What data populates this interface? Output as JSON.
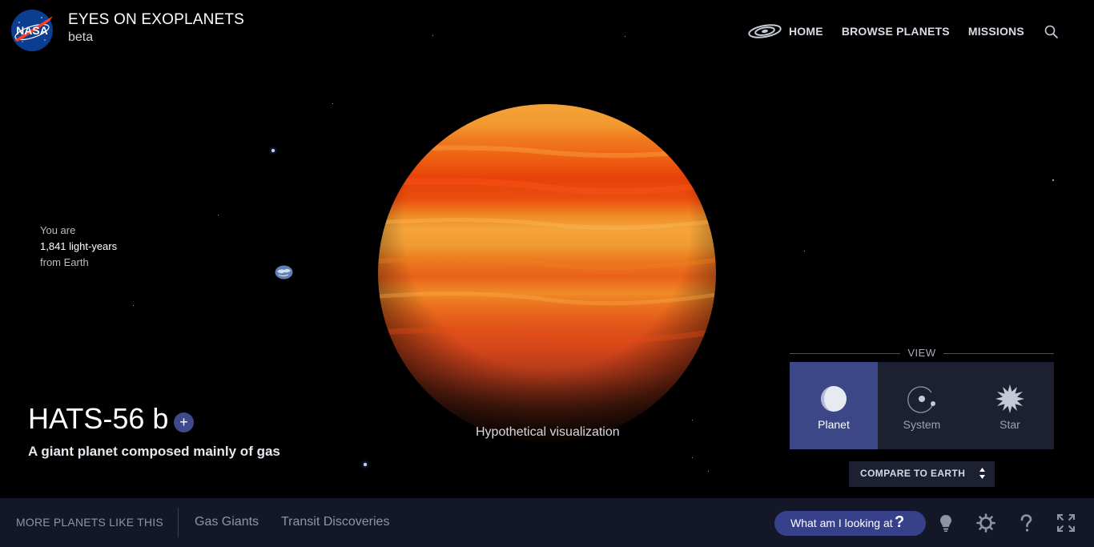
{
  "header": {
    "logo_text": "NASA",
    "title": "EYES ON EXOPLANETS",
    "subtitle": "beta",
    "nav": [
      {
        "label": "HOME",
        "icon": "galaxy-icon"
      },
      {
        "label": "BROWSE PLANETS"
      },
      {
        "label": "MISSIONS"
      }
    ],
    "search_icon": "search-icon"
  },
  "distance": {
    "prefix": "You are",
    "value": "1,841 light-years",
    "suffix": "from Earth",
    "earth_icon": "earth-icon"
  },
  "planet": {
    "name": "HATS-56 b",
    "add_label": "+",
    "description": "A giant planet composed mainly of gas",
    "caption": "Hypothetical visualization",
    "colors": {
      "band_light": "#f4a53a",
      "band_red": "#e8410a",
      "band_mid": "#ec7a1f"
    }
  },
  "view": {
    "label": "VIEW",
    "options": [
      {
        "label": "Planet",
        "icon": "planet-icon",
        "active": true
      },
      {
        "label": "System",
        "icon": "system-icon",
        "active": false
      },
      {
        "label": "Star",
        "icon": "star-icon",
        "active": false
      }
    ],
    "compare_label": "COMPARE TO EARTH"
  },
  "bottom_bar": {
    "more_label": "MORE PLANETS LIKE THIS",
    "tags": [
      "Gas Giants",
      "Transit Discoveries"
    ],
    "help_button": {
      "label": "What am I looking at",
      "symbol": "?"
    },
    "tools": [
      "lightbulb-icon",
      "settings-icon",
      "help-icon",
      "fullscreen-icon"
    ]
  },
  "colors": {
    "accent": "#3b4787",
    "panel": "#1d2030",
    "bottom_bar": "#141728",
    "nasa_red": "#fc3d21",
    "nasa_blue": "#0b3d91"
  }
}
